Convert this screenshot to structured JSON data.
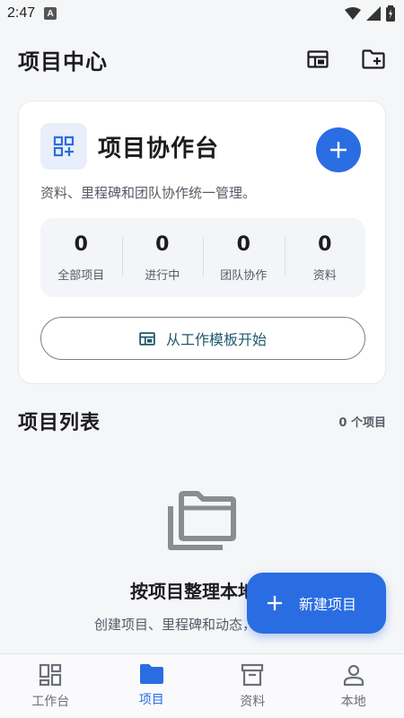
{
  "status_bar": {
    "time": "2:47",
    "badge": "A"
  },
  "header": {
    "title": "项目中心"
  },
  "card": {
    "title": "项目协作台",
    "description": "资料、里程碑和团队协作统一管理。",
    "stats": [
      {
        "value": "0",
        "label": "全部项目"
      },
      {
        "value": "0",
        "label": "进行中"
      },
      {
        "value": "0",
        "label": "团队协作"
      },
      {
        "value": "0",
        "label": "资料"
      }
    ],
    "template_button": "从工作模板开始"
  },
  "list": {
    "title": "项目列表",
    "count": "0 个项目",
    "empty_title": "按项目整理本地",
    "empty_desc": "创建项目、里程碑和动态，档文件。"
  },
  "fab": {
    "label": "新建项目"
  },
  "nav": {
    "items": [
      {
        "label": "工作台",
        "icon": "dashboard-icon"
      },
      {
        "label": "项目",
        "icon": "folder-icon"
      },
      {
        "label": "资料",
        "icon": "archive-icon"
      },
      {
        "label": "本地",
        "icon": "person-icon"
      }
    ],
    "active_index": 1
  },
  "colors": {
    "accent": "#2a6de3",
    "background": "#f5f6f8",
    "card": "#ffffff"
  }
}
